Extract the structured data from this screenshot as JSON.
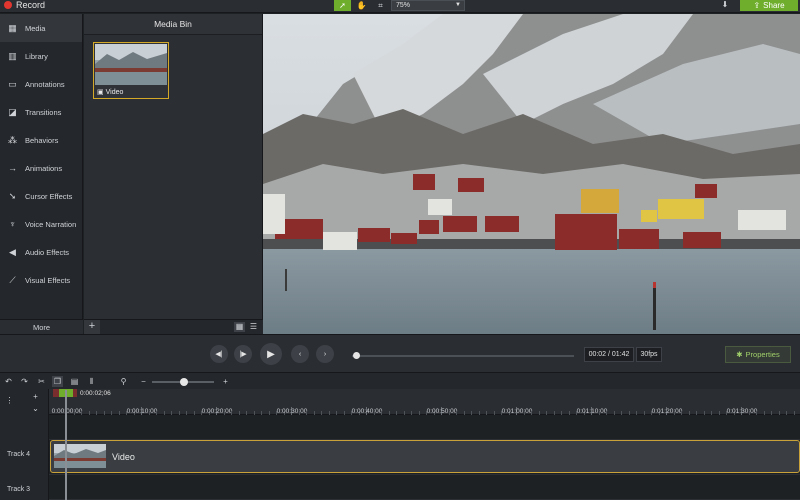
{
  "topbar": {
    "record_label": "Record",
    "zoom_value": "75%",
    "share_label": "Share"
  },
  "leftnav": {
    "items": [
      {
        "label": "Media",
        "icon": "film-icon"
      },
      {
        "label": "Library",
        "icon": "library-icon"
      },
      {
        "label": "Annotations",
        "icon": "annotation-icon"
      },
      {
        "label": "Transitions",
        "icon": "transition-icon"
      },
      {
        "label": "Behaviors",
        "icon": "behavior-icon"
      },
      {
        "label": "Animations",
        "icon": "animation-icon"
      },
      {
        "label": "Cursor Effects",
        "icon": "cursor-icon"
      },
      {
        "label": "Voice Narration",
        "icon": "microphone-icon"
      },
      {
        "label": "Audio Effects",
        "icon": "speaker-icon"
      },
      {
        "label": "Visual Effects",
        "icon": "wand-icon"
      }
    ],
    "more_label": "More"
  },
  "media_bin": {
    "title": "Media Bin",
    "clips": [
      {
        "label": "Video"
      }
    ]
  },
  "player": {
    "time": "00:02 / 01:42",
    "fps": "30fps",
    "properties_label": "Properties"
  },
  "timeline": {
    "playhead_time": "0:00:02;06",
    "ruler": [
      "0:00:00;00",
      "0:00:10;00",
      "0:00:20;00",
      "0:00:30;00",
      "0:00:40;00",
      "0:00:50;00",
      "0:01:00;00",
      "0:01:10;00",
      "0:01:20;00",
      "0:01:30;00"
    ],
    "tracks": [
      {
        "label": "Track 4",
        "clip": "Video"
      },
      {
        "label": "Track 3"
      }
    ]
  },
  "colors": {
    "accent": "#6fae2d",
    "record": "#e0362f",
    "selection": "#d4a928"
  }
}
